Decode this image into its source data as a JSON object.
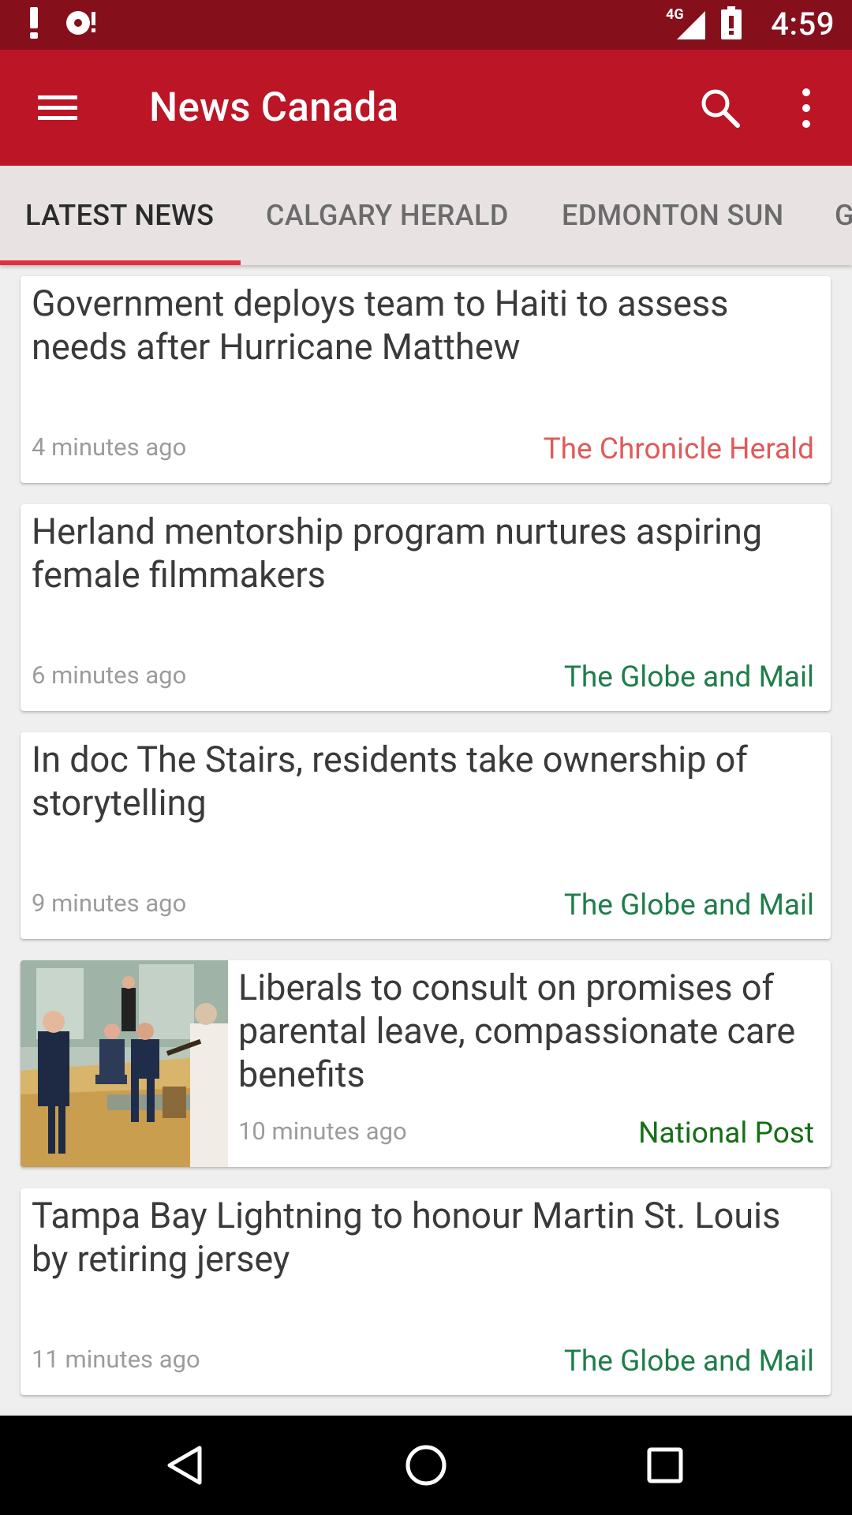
{
  "status_bar": {
    "time": "4:59",
    "network": "4G",
    "icons": [
      "alert-icon",
      "sync-alert-icon",
      "signal-4g-icon",
      "battery-alert-icon"
    ]
  },
  "app_bar": {
    "title": "News Canada",
    "icons": [
      "menu-icon",
      "search-icon",
      "more-vert-icon"
    ],
    "color": "#bb1526"
  },
  "tabs": [
    {
      "label": "LATEST NEWS",
      "active": true
    },
    {
      "label": "CALGARY HERALD",
      "active": false
    },
    {
      "label": "EDMONTON SUN",
      "active": false
    },
    {
      "label": "G",
      "active": false
    }
  ],
  "articles": [
    {
      "headline": "Government deploys team to Haiti to assess needs after Hurricane Matthew",
      "time": "4 minutes ago",
      "source": "The Chronicle Herald",
      "source_color": "#e05a5a",
      "has_image": false
    },
    {
      "headline": "Herland mentorship program nurtures aspiring female filmmakers",
      "time": "6 minutes ago",
      "source": "The Globe and Mail",
      "source_color": "#1f7d4a",
      "has_image": false
    },
    {
      "headline": "In doc The Stairs, residents take ownership of storytelling",
      "time": "9 minutes ago",
      "source": "The Globe and Mail",
      "source_color": "#1f7d4a",
      "has_image": false
    },
    {
      "headline": "Liberals to consult on promises of parental leave, compassionate care benefits",
      "time": "10 minutes ago",
      "source": "National Post",
      "source_color": "#166e17",
      "has_image": true
    },
    {
      "headline": "Tampa Bay Lightning to honour Martin St. Louis by retiring jersey",
      "time": "11 minutes ago",
      "source": "The Globe and Mail",
      "source_color": "#1f7d4a",
      "has_image": false
    }
  ],
  "nav_bar": {
    "icons": [
      "back-icon",
      "home-icon",
      "recents-icon"
    ]
  }
}
